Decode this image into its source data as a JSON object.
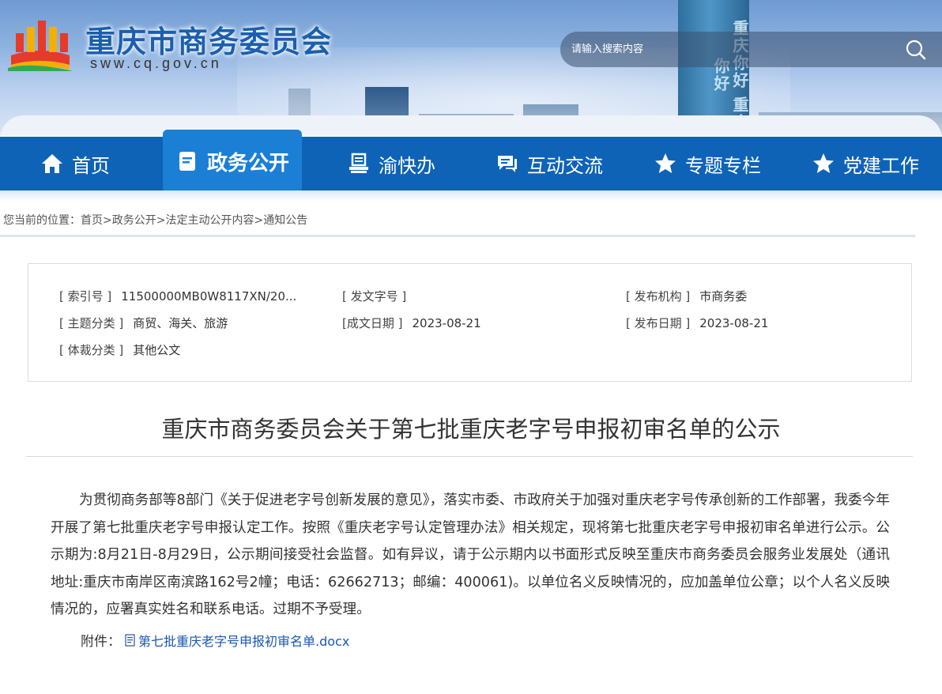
{
  "header": {
    "site_title": "重庆市商务委员会",
    "site_domain": "sww.cq.gov.cn",
    "tower_text": "重庆你好 重庆你好"
  },
  "search": {
    "placeholder": "请输入搜索内容"
  },
  "nav": {
    "items": [
      {
        "label": "首页",
        "icon": "home-icon"
      },
      {
        "label": "政务公开",
        "icon": "document-icon"
      },
      {
        "label": "渝快办",
        "icon": "service-desk-icon"
      },
      {
        "label": "互动交流",
        "icon": "chat-icon"
      },
      {
        "label": "专题专栏",
        "icon": "star-icon"
      },
      {
        "label": "党建工作",
        "icon": "star-icon"
      }
    ],
    "active_index": 1
  },
  "breadcrumb": {
    "prefix": "您当前的位置：",
    "items": [
      "首页",
      "政务公开",
      "法定主动公开内容",
      "通知公告"
    ],
    "separator": ">"
  },
  "info": {
    "index_key": "[ 索引号 ]",
    "index_val": "11500000MB0W8117XN/20...",
    "docno_key": "[ 发文字号 ]",
    "docno_val": "",
    "org_key": "[ 发布机构 ]",
    "org_val": "市商务委",
    "topic_key": "[ 主题分类 ]",
    "topic_val": "商贸、海关、旅游",
    "created_key": "[成文日期 ]",
    "created_val": "2023-08-21",
    "published_key": "[ 发布日期 ]",
    "published_val": "2023-08-21",
    "genre_key": "[ 体裁分类 ]",
    "genre_val": "其他公文"
  },
  "article": {
    "title": "重庆市商务委员会关于第七批重庆老字号申报初审名单的公示",
    "body": "为贯彻商务部等8部门《关于促进老字号创新发展的意见》，落实市委、市政府关于加强对重庆老字号传承创新的工作部署，我委今年开展了第七批重庆老字号申报认定工作。按照《重庆老字号认定管理办法》相关规定，现将第七批重庆老字号申报初审名单进行公示。公示期为:8月21日-8月29日，公示期间接受社会监督。如有异议，请于公示期内以书面形式反映至重庆市商务委员会服务业发展处（通讯地址:重庆市南岸区南滨路162号2幢；电话：62662713；邮编：400061)。以单位名义反映情况的，应加盖单位公章；以个人名义反映情况的，应署真实姓名和联系电话。过期不予受理。",
    "attachment_label": "附件：",
    "attachment_file": "第七批重庆老字号申报初审名单.docx"
  },
  "colors": {
    "nav_bg": "#0e63b7",
    "nav_active": "#1b7fd6",
    "title_blue": "#1b5fae",
    "link": "#1a56b0"
  }
}
